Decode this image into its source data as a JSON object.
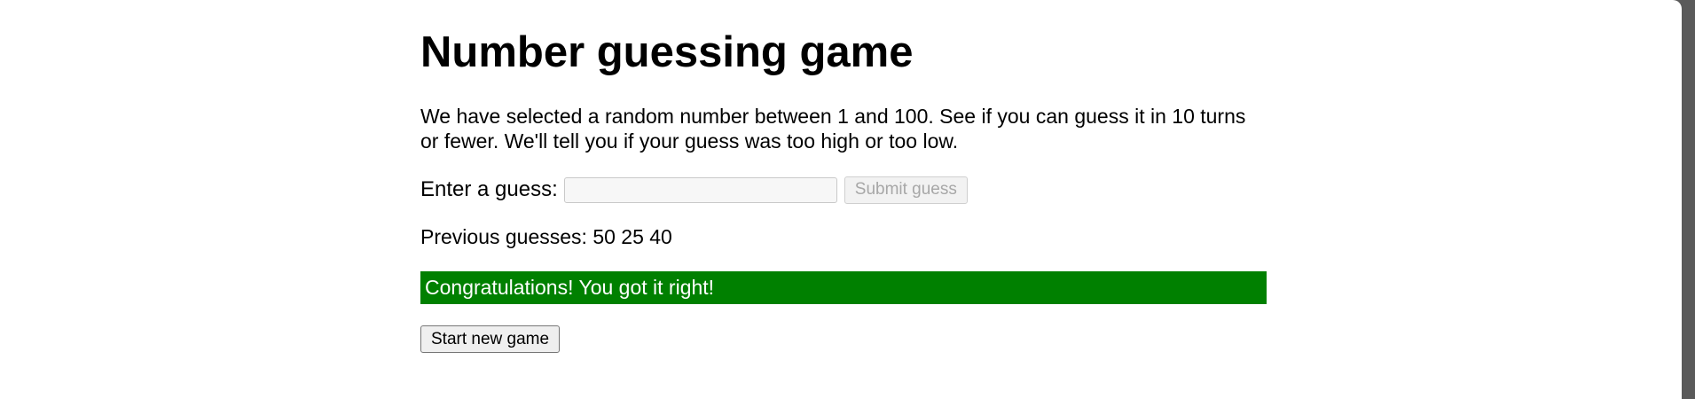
{
  "page": {
    "title": "Number guessing game",
    "intro": "We have selected a random number between 1 and 100. See if you can guess it in 10 turns or fewer. We'll tell you if your guess was too high or too low."
  },
  "form": {
    "label": "Enter a guess:",
    "input_value": "",
    "submit_label": "Submit guess",
    "submit_disabled": true,
    "input_disabled": true
  },
  "guesses": {
    "text": "Previous guesses: 50 25 40",
    "values": [
      50,
      25,
      40
    ]
  },
  "result": {
    "message": "Congratulations! You got it right!",
    "color": "#008000"
  },
  "actions": {
    "new_game_label": "Start new game"
  }
}
